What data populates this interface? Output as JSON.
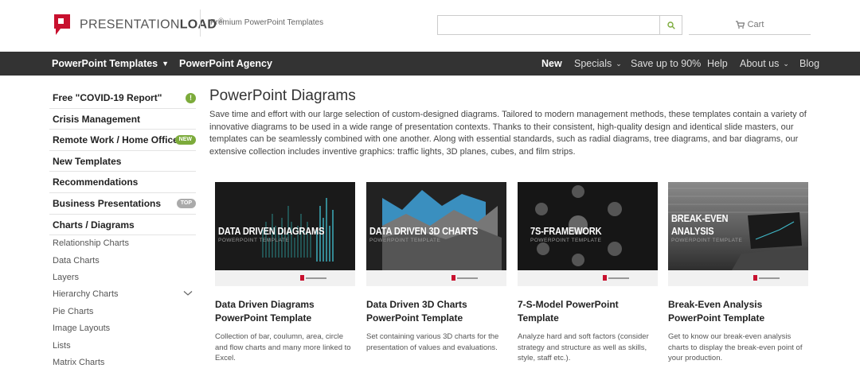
{
  "header": {
    "logo_text_light": "PRESENTATION",
    "logo_text_bold": "LOAD",
    "logo_reg": "®",
    "tagline": "Premium PowerPoint Templates",
    "search_placeholder": "",
    "cart_label": "Cart"
  },
  "nav": {
    "left": [
      {
        "label": "PowerPoint Templates"
      },
      {
        "label": "PowerPoint Agency"
      }
    ],
    "right": [
      {
        "label": "New"
      },
      {
        "label": "Specials"
      },
      {
        "label": "Save up to 90%"
      },
      {
        "label": "Help"
      },
      {
        "label": "About us"
      },
      {
        "label": "Blog"
      }
    ]
  },
  "sidebar": {
    "items": [
      {
        "label": "Free \"COVID-19 Report\"",
        "badge": "!"
      },
      {
        "label": "Crisis Management"
      },
      {
        "label": "Remote Work / Home Office",
        "badge": "NEW"
      },
      {
        "label": "New Templates"
      },
      {
        "label": "Recommendations"
      },
      {
        "label": "Business Presentations",
        "badge": "TOP"
      },
      {
        "label": "Charts / Diagrams"
      }
    ],
    "subitems": [
      {
        "label": "Relationship Charts"
      },
      {
        "label": "Data Charts"
      },
      {
        "label": "Layers"
      },
      {
        "label": "Hierarchy Charts"
      },
      {
        "label": "Pie Charts"
      },
      {
        "label": "Image Layouts"
      },
      {
        "label": "Lists"
      },
      {
        "label": "Matrix Charts"
      }
    ]
  },
  "main": {
    "title": "PowerPoint Diagrams",
    "intro": "Save time and effort with our large selection of custom-designed diagrams. Tailored to modern management methods, these templates contain a variety of innovative diagrams to be used in a wide range of presentation contexts. Thanks to their consistent, high-quality design and identical slide masters, our templates can be seamlessly combined with one another.  Along with essential standards, such as radial diagrams, tree diagrams, and bar diagrams, our extensive collection includes inventive graphics: traffic lights, 3D planes, cubes, and film strips.",
    "cards": [
      {
        "thumb_title": "DATA DRIVEN DIAGRAMS",
        "thumb_sub": "POWERPOINT TEMPLATE",
        "title": "Data Driven Diagrams PowerPoint Template",
        "desc": "Collection of bar, coulumn, area, circle and flow charts and many more linked to Excel."
      },
      {
        "thumb_title": "DATA DRIVEN 3D CHARTS",
        "thumb_sub": "POWERPOINT TEMPLATE",
        "title": "Data Driven 3D Charts PowerPoint Template",
        "desc": "Set containing various 3D charts for the presentation of values and evaluations."
      },
      {
        "thumb_title": "7S-FRAMEWORK",
        "thumb_sub": "POWERPOINT TEMPLATE",
        "title": "7-S-Model PowerPoint Template",
        "desc": "Analyze hard and soft factors (consider strategy and structure as well as skills, style, staff etc.)."
      },
      {
        "thumb_title": "BREAK-EVEN",
        "thumb_title2": "ANALYSIS",
        "thumb_sub": "POWERPOINT TEMPLATE",
        "title": "Break-Even Analysis PowerPoint Template",
        "desc": "Get to know our break-even analysis charts to display the break-even point of your production."
      }
    ]
  },
  "colors": {
    "brand_red": "#c8102e",
    "nav_bg": "#333333",
    "badge_green": "#7cab3b",
    "badge_gray": "#aaaaaa"
  }
}
